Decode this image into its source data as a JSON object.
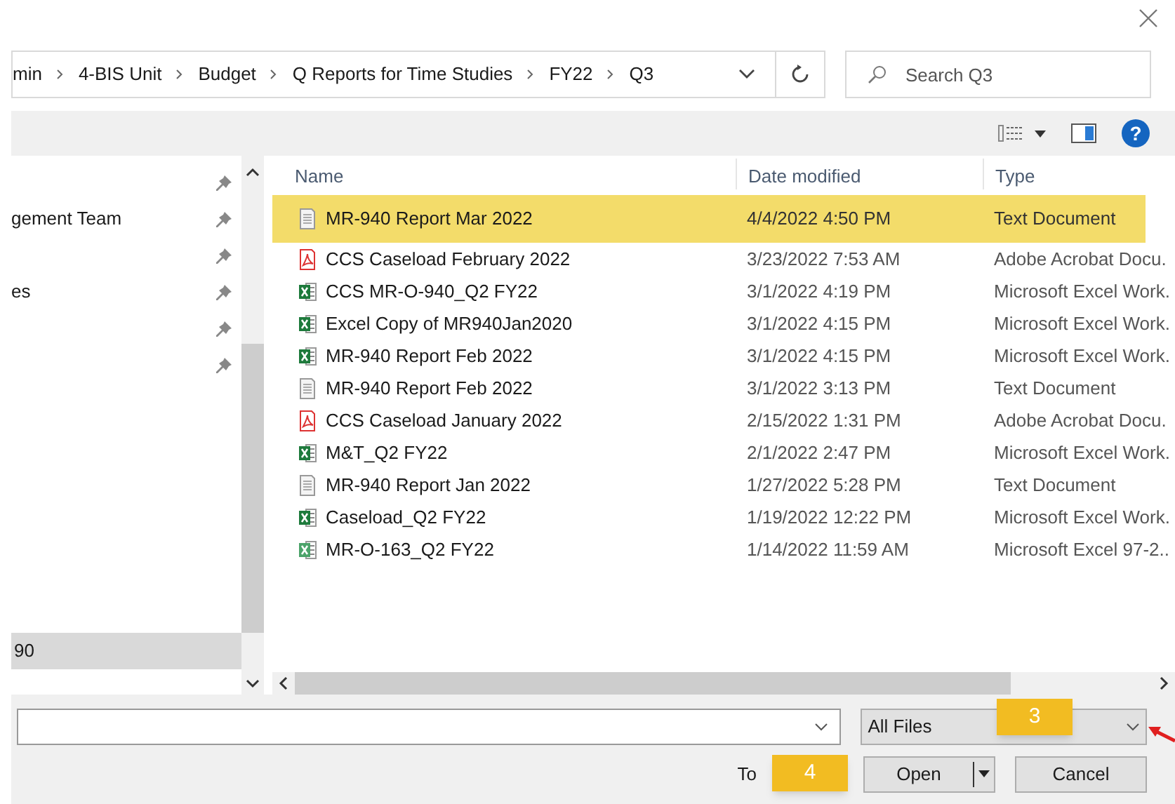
{
  "breadcrumb": [
    "min",
    "4-BIS Unit",
    "Budget",
    "Q Reports for Time Studies",
    "FY22",
    "Q3"
  ],
  "search": {
    "placeholder": "Search Q3"
  },
  "nav": [
    {
      "pinned": true
    },
    {
      "label": "gement Team",
      "pinned": true
    },
    {
      "pinned": true
    },
    {
      "label": "es",
      "pinned": true
    },
    {
      "pinned": true
    },
    {
      "pinned": true
    }
  ],
  "nav_bottom": {
    "label": "90",
    "selected": true
  },
  "columns": [
    "Name",
    "Date modified",
    "Type"
  ],
  "files": [
    {
      "kind": "text",
      "name": "MR-940 Report Mar 2022",
      "date": "4/4/2022 4:50 PM",
      "type": "Text Document",
      "selected": true
    },
    {
      "kind": "pdf",
      "name": "CCS Caseload February 2022",
      "date": "3/23/2022 7:53 AM",
      "type": "Adobe Acrobat Docu.",
      "selected": false
    },
    {
      "kind": "excel",
      "name": "CCS MR-O-940_Q2 FY22",
      "date": "3/1/2022 4:19 PM",
      "type": "Microsoft Excel Work.",
      "selected": false
    },
    {
      "kind": "excel",
      "name": "Excel Copy of MR940Jan2020",
      "date": "3/1/2022 4:15 PM",
      "type": "Microsoft Excel Work.",
      "selected": false
    },
    {
      "kind": "excel",
      "name": "MR-940 Report Feb 2022",
      "date": "3/1/2022 4:15 PM",
      "type": "Microsoft Excel Work.",
      "selected": false
    },
    {
      "kind": "text",
      "name": "MR-940 Report Feb 2022",
      "date": "3/1/2022 3:13 PM",
      "type": "Text Document",
      "selected": false
    },
    {
      "kind": "pdf",
      "name": "CCS Caseload January 2022",
      "date": "2/15/2022 1:31 PM",
      "type": "Adobe Acrobat Docu.",
      "selected": false
    },
    {
      "kind": "excel",
      "name": "M&T_Q2 FY22",
      "date": "2/1/2022 2:47 PM",
      "type": "Microsoft Excel Work.",
      "selected": false
    },
    {
      "kind": "text",
      "name": "MR-940 Report Jan 2022",
      "date": "1/27/2022 5:28 PM",
      "type": "Text Document",
      "selected": false
    },
    {
      "kind": "excel",
      "name": "Caseload_Q2 FY22",
      "date": "1/19/2022 12:22 PM",
      "type": "Microsoft Excel Work.",
      "selected": false
    },
    {
      "kind": "excel_old",
      "name": "MR-O-163_Q2 FY22",
      "date": "1/14/2022 11:59 AM",
      "type": "Microsoft Excel 97-2..",
      "selected": false
    }
  ],
  "filter": {
    "value": "All Files"
  },
  "tools_label": "To",
  "buttons": [
    "Open",
    "Cancel"
  ],
  "callouts": [
    "3",
    "4"
  ],
  "help_icon": "?"
}
